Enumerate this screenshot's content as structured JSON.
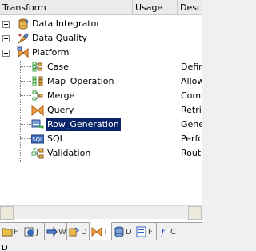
{
  "header": {
    "transform": "Transform",
    "usage": "Usage",
    "description": "Desc"
  },
  "tree": {
    "categories": [
      {
        "label": "Data Integrator",
        "expanded": false
      },
      {
        "label": "Data Quality",
        "expanded": false
      },
      {
        "label": "Platform",
        "expanded": true
      }
    ],
    "platform_items": [
      {
        "label": "Case",
        "desc": "Defir"
      },
      {
        "label": "Map_Operation",
        "desc": "Allow"
      },
      {
        "label": "Merge",
        "desc": "Comb"
      },
      {
        "label": "Query",
        "desc": "Retri"
      },
      {
        "label": "Row_Generation",
        "desc": "Gene",
        "selected": true
      },
      {
        "label": "SQL",
        "desc": "Perfo"
      },
      {
        "label": "Validation",
        "desc": "Rout"
      }
    ]
  },
  "tabs": [
    {
      "letter": "F",
      "icon": "folder-icon"
    },
    {
      "letter": "J",
      "icon": "job-icon"
    },
    {
      "letter": "W",
      "icon": "workflow-icon"
    },
    {
      "letter": "D",
      "icon": "dataflow-icon"
    },
    {
      "letter": "T",
      "icon": "transform-icon",
      "active": true
    },
    {
      "letter": "D",
      "icon": "datastore-icon"
    },
    {
      "letter": "F",
      "icon": "format-icon"
    },
    {
      "letter": "C",
      "icon": "function-icon"
    }
  ],
  "bottom_text": "D"
}
